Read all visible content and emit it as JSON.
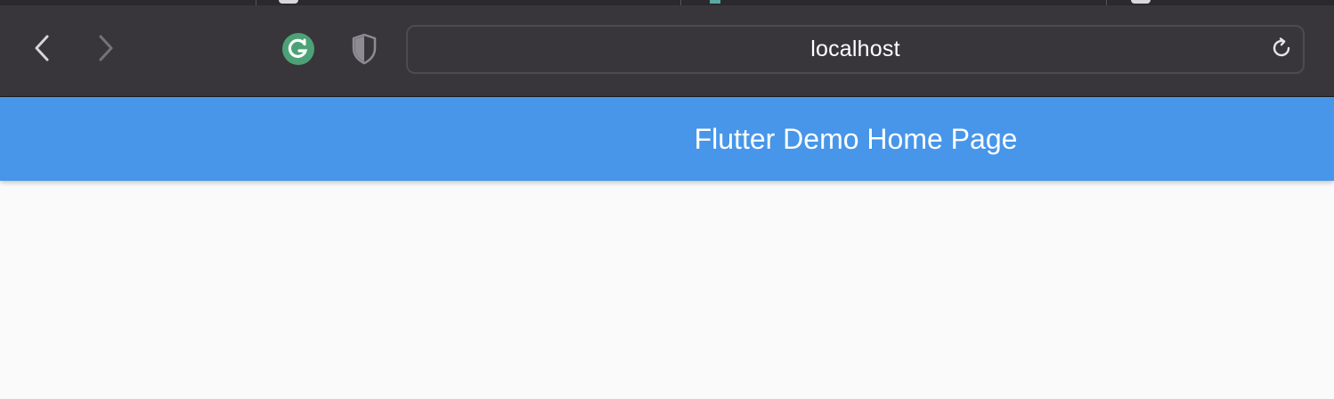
{
  "browser": {
    "toolbar": {
      "back_icon": "chevron-left-icon",
      "forward_icon": "chevron-right-icon",
      "grammarly_icon": "grammarly-icon",
      "shield_icon": "shield-icon",
      "reload_icon": "reload-icon"
    },
    "address_bar": {
      "url": "localhost"
    }
  },
  "app": {
    "appbar": {
      "title": "Flutter Demo Home Page",
      "color": "#4796e9"
    },
    "background_color": "#fafafa"
  }
}
